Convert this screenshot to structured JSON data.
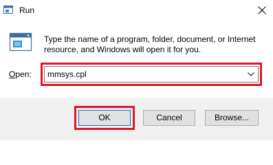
{
  "window": {
    "title": "Run"
  },
  "icons": {
    "title_icon": "run-app-icon",
    "close_icon": "close-icon",
    "run_icon": "run-app-icon",
    "dropdown_icon": "chevron-down-icon"
  },
  "description": "Type the name of a program, folder, document, or Internet resource, and Windows will open it for you.",
  "open_field": {
    "label_mnemonic": "O",
    "label_rest": "pen:",
    "value": "mmsys.cpl"
  },
  "buttons": {
    "ok": "OK",
    "cancel": "Cancel",
    "browse": "Browse..."
  },
  "colors": {
    "highlight": "#e0142b",
    "accent": "#0078d7",
    "footer_bg": "#f0f0f0"
  }
}
